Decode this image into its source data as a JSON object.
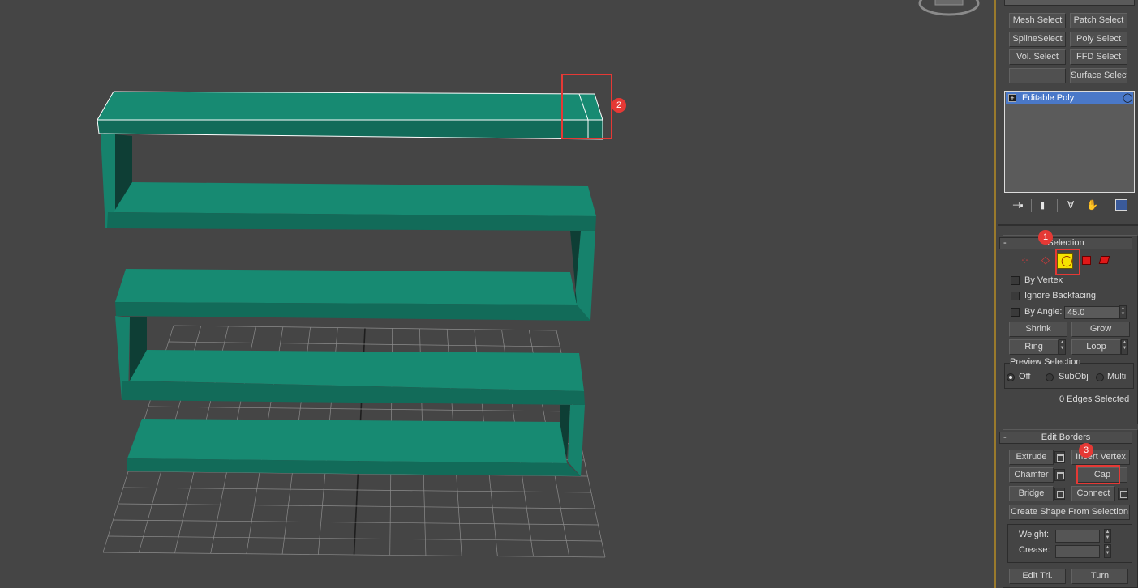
{
  "modifier_list": {
    "buttons": [
      "Mesh Select",
      "Patch Select",
      "SplineSelect",
      "Poly Select",
      "Vol. Select",
      "FFD Select",
      "",
      "Surface Select"
    ],
    "stack": [
      "Editable Poly"
    ]
  },
  "selection": {
    "title": "Selection",
    "by_vertex": "By Vertex",
    "ignore_backfacing": "Ignore Backfacing",
    "by_angle": "By Angle:",
    "angle_value": "45.0",
    "shrink": "Shrink",
    "grow": "Grow",
    "ring": "Ring",
    "loop": "Loop",
    "preview_title": "Preview Selection",
    "preview_options": [
      "Off",
      "SubObj",
      "Multi"
    ],
    "preview_selected": "Off",
    "status": "0 Edges Selected"
  },
  "edit_borders": {
    "title": "Edit Borders",
    "extrude": "Extrude",
    "insert_vertex": "Insert Vertex",
    "chamfer": "Chamfer",
    "cap": "Cap",
    "bridge": "Bridge",
    "connect": "Connect",
    "create_shape": "Create Shape From Selection",
    "weight_label": "Weight:",
    "crease_label": "Crease:",
    "edit_tri": "Edit Tri.",
    "turn": "Turn"
  },
  "annotations": [
    "1",
    "2",
    "3"
  ],
  "colors": {
    "viewport_bg": "#454545",
    "model": "#178a72",
    "highlight": "#e53935",
    "stack_selected": "#4a78c8",
    "active_mode": "#f7e300"
  },
  "icons": [
    "pin-stack-icon",
    "show-end-result-icon",
    "make-unique-icon",
    "remove-modifier-icon",
    "configure-sets-icon",
    "vertex-mode-icon",
    "edge-mode-icon",
    "border-mode-icon",
    "polygon-mode-icon",
    "element-mode-icon",
    "viewcube-icon"
  ]
}
